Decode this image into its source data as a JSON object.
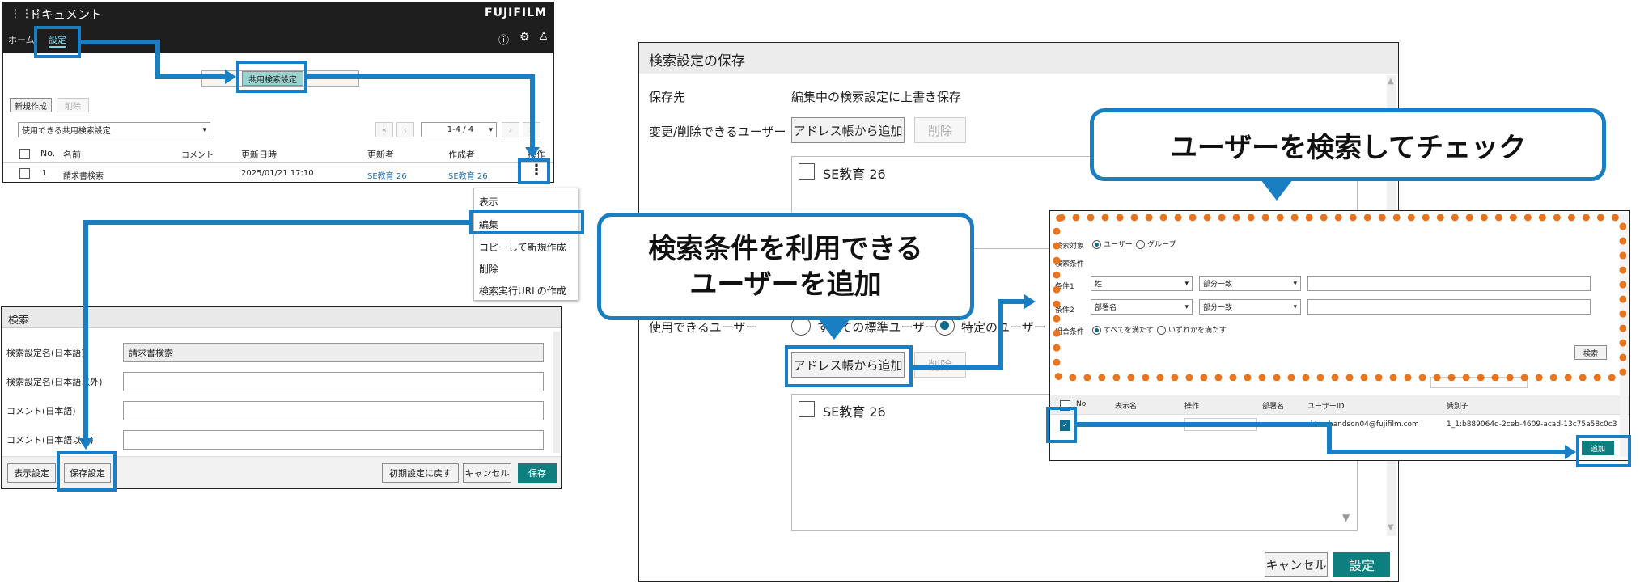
{
  "app": {
    "title": "ドキュメント",
    "brand": "FUJIFILM",
    "nav": [
      "ホーム",
      "設定"
    ],
    "icons": [
      "grid-icon",
      "help-icon",
      "gear-icon",
      "user-icon"
    ]
  },
  "list_panel": {
    "shared_search_button": "共用検索設定",
    "new_button": "新規作成",
    "delete_button": "削除",
    "filter_select": "使用できる共用検索設定",
    "pager": "1-4 / 4",
    "columns": [
      "No.",
      "名前",
      "コメント",
      "更新日時",
      "更新者",
      "作成者",
      "操作"
    ],
    "rows": [
      {
        "no": "1",
        "name": "請求書検索",
        "comment": "",
        "updated": "2025/01/21 17:10",
        "updater": "SE教育 26",
        "creator": "SE教育 26"
      }
    ]
  },
  "context_menu": {
    "items": [
      "表示",
      "編集",
      "コピーして新規作成",
      "削除",
      "検索実行URLの作成"
    ]
  },
  "search_panel": {
    "title": "検索",
    "fields": [
      {
        "label": "検索設定名(日本語)",
        "value": "請求書検索"
      },
      {
        "label": "検索設定名(日本語以外)",
        "value": ""
      },
      {
        "label": "コメント(日本語)",
        "value": ""
      },
      {
        "label": "コメント(日本語以外)",
        "value": ""
      }
    ],
    "buttons": {
      "display": "表示設定",
      "save_settings": "保存設定",
      "reset": "初期設定に戻す",
      "cancel": "キャンセル",
      "save": "保存"
    }
  },
  "save_dialog": {
    "title": "検索設定の保存",
    "dest_label": "保存先",
    "dest_value": "編集中の検索設定に上書き保存",
    "editors_label": "変更/削除できるユーザー",
    "address_book_button": "アドレス帳から追加",
    "delete_button": "削除",
    "user_entry": "SE教育 26",
    "users_label": "使用できるユーザー",
    "radio_standard": "すべての標準ユーザー",
    "radio_specific": "特定のユーザー",
    "cancel_button": "キャンセル",
    "ok_button": "設定"
  },
  "user_search_dialog": {
    "target_label": "検索対象",
    "target_user": "ユーザー",
    "target_group": "グループ",
    "cond_label": "検索条件",
    "cond1_label": "条件1",
    "cond1_field": "姓",
    "cond1_match": "部分一致",
    "cond2_label": "条件2",
    "cond2_field": "部署名",
    "cond2_match": "部分一致",
    "combine_label": "組合条件",
    "combine_all": "すべてを満たす",
    "combine_any": "いずれかを満たす",
    "search_button": "検索",
    "columns": [
      "No.",
      "表示名",
      "操作",
      "部署名",
      "ユーザーID",
      "識別子"
    ],
    "result_user_id": "rkt-sehandson04@fujifilm.com",
    "result_identifier": "1_1:b889064d-2ceb-4609-acad-13c75a58c0c3",
    "add_button": "追加"
  },
  "callouts": {
    "search_and_check": "ユーザーを検索してチェック",
    "add_users_line1": "検索条件を利用できる",
    "add_users_line2": "ユーザーを追加"
  },
  "colors": {
    "accent": "#1a7fc2",
    "teal": "#0e7f7f",
    "orange": "#e8741e",
    "header": "#1e1e1e"
  }
}
